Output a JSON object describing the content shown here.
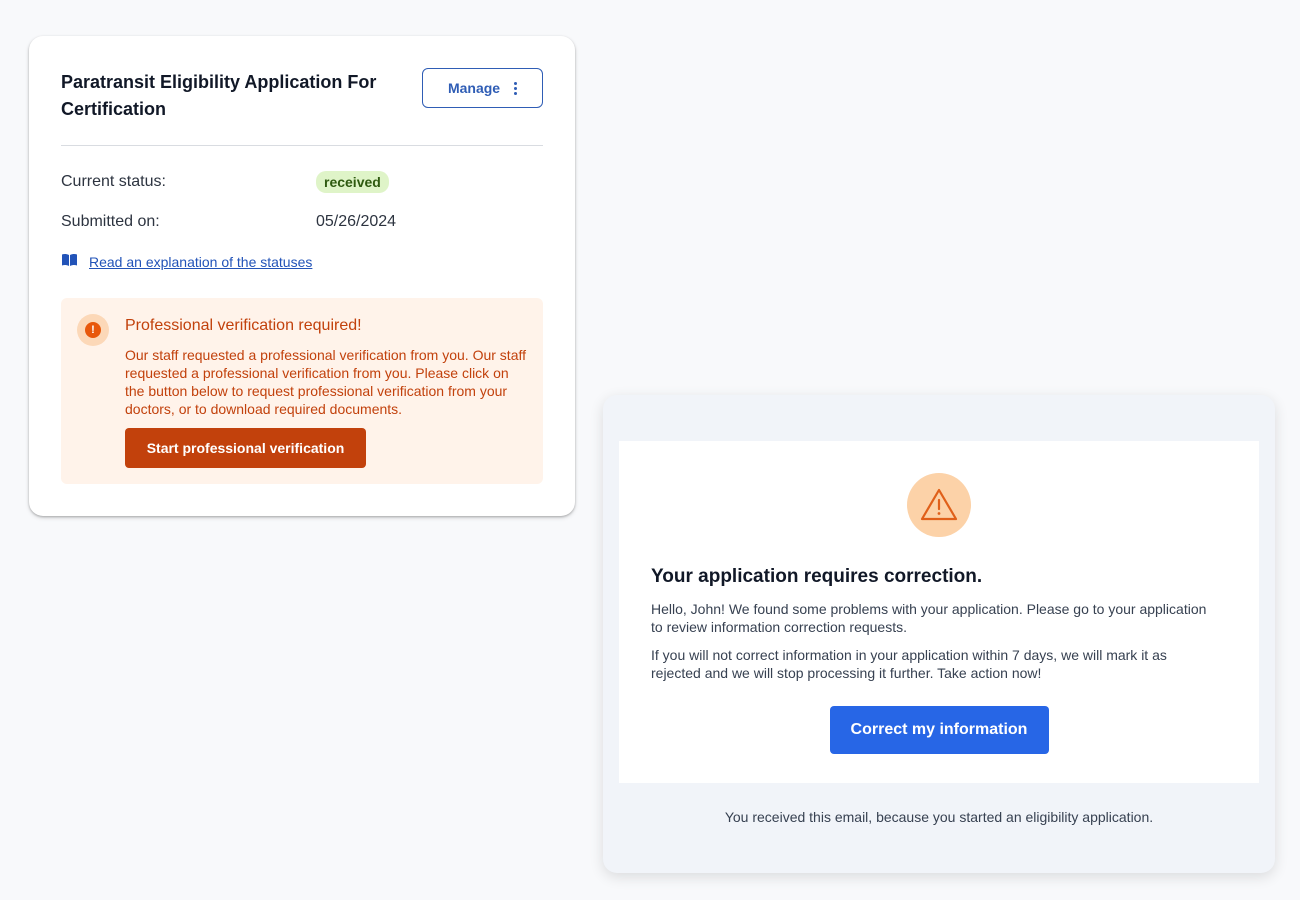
{
  "application_card": {
    "title": "Paratransit Eligibility Application For Certification",
    "manage_label": "Manage",
    "status_label": "Current status:",
    "status_value": "received",
    "submitted_label": "Submitted on:",
    "submitted_value": "05/26/2024",
    "explanation_link": "Read an explanation of the statuses",
    "alert": {
      "title": "Professional verification required!",
      "text": "Our staff requested a professional verification from you. Our staff requested a professional verification from you. Please click on the button below to request professional verification from your doctors, or to download required documents.",
      "button_label": "Start professional verification"
    }
  },
  "email": {
    "title": "Your application requires correction.",
    "paragraph_1": "Hello, John! We found some problems with your application. Please go to your application to review information correction requests.",
    "paragraph_2": "If you will not correct information in your application within 7 days, we will mark it as rejected and we will stop processing it further. Take action now!",
    "button_label": "Correct my information",
    "footer": "You received this email, because you started an eligibility application."
  },
  "colors": {
    "link_blue": "#2f5db5",
    "alert_orange": "#c2410c",
    "alert_background": "#fff3ea",
    "badge_green": "#dff4c8",
    "primary_button": "#2766e6"
  },
  "icons": [
    "more-vertical-icon",
    "book-open-icon",
    "exclamation-circle-icon",
    "warning-triangle-icon"
  ]
}
